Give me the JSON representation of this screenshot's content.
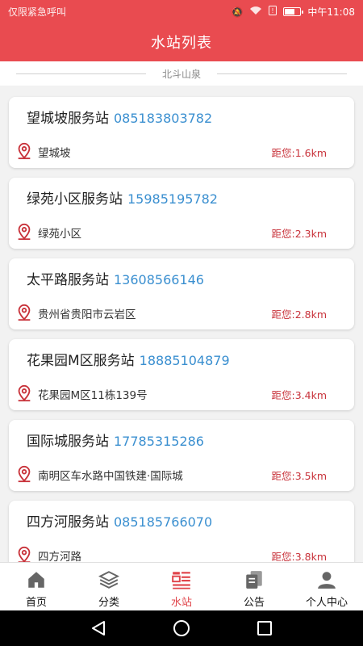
{
  "status_bar": {
    "carrier": "仅限紧急呼叫",
    "time": "中午11:08",
    "battery_level": 0.7
  },
  "header": {
    "title": "水站列表"
  },
  "location": {
    "name": "北斗山泉"
  },
  "stations": [
    {
      "name": "望城坡服务站",
      "phone": "085183803782",
      "address": "望城坡",
      "distance": "距您:1.6km"
    },
    {
      "name": "绿苑小区服务站",
      "phone": "15985195782",
      "address": "绿苑小区",
      "distance": "距您:2.3km"
    },
    {
      "name": "太平路服务站",
      "phone": "13608566146",
      "address": "贵州省贵阳市云岩区",
      "distance": "距您:2.8km"
    },
    {
      "name": "花果园M区服务站",
      "phone": "18885104879",
      "address": "花果园M区11栋139号",
      "distance": "距您:3.4km"
    },
    {
      "name": "国际城服务站",
      "phone": "17785315286",
      "address": "南明区车水路中国铁建·国际城",
      "distance": "距您:3.5km"
    },
    {
      "name": "四方河服务站",
      "phone": "085185766070",
      "address": "四方河路",
      "distance": "距您:3.8km"
    }
  ],
  "tabs": [
    {
      "label": "首页",
      "icon": "home-icon"
    },
    {
      "label": "分类",
      "icon": "layers-icon"
    },
    {
      "label": "水站",
      "icon": "list-icon",
      "active": true
    },
    {
      "label": "公告",
      "icon": "document-icon"
    },
    {
      "label": "个人中心",
      "icon": "user-icon"
    }
  ],
  "colors": {
    "primary": "#e94b50",
    "phone": "#3a8fd0",
    "distance": "#c8323a"
  }
}
